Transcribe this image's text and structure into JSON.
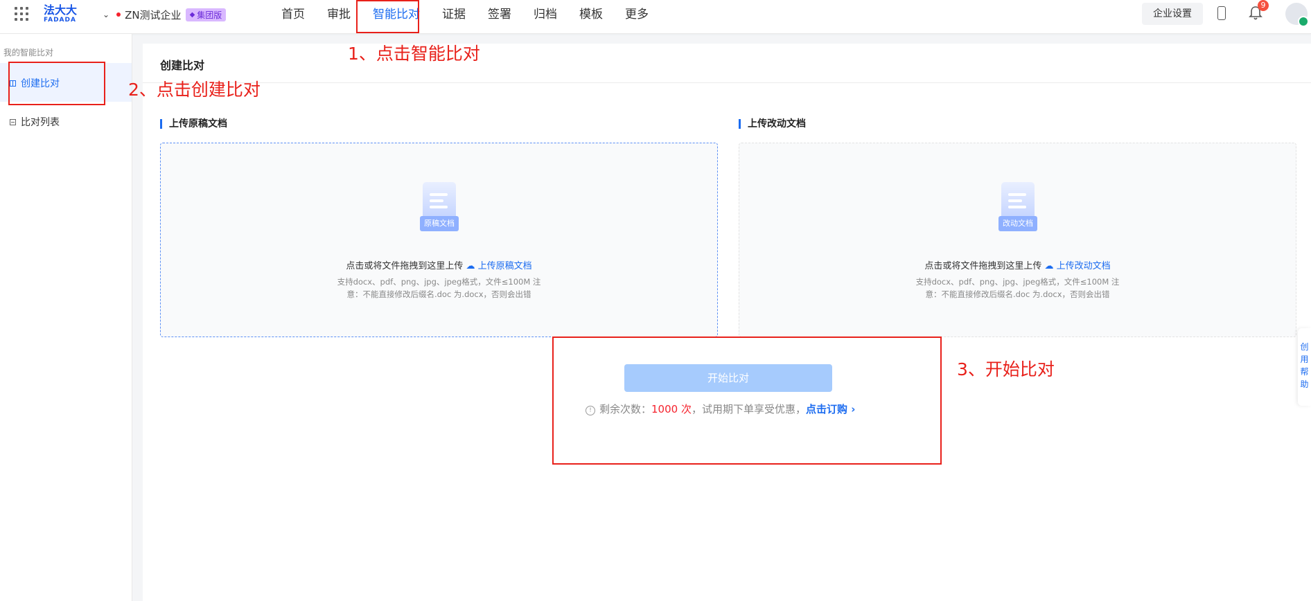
{
  "header": {
    "logo_cn": "法大大",
    "logo_en": "FADADA",
    "org_name": "ZN测试企业",
    "org_badge": "集团版",
    "nav": [
      {
        "label": "首页"
      },
      {
        "label": "审批"
      },
      {
        "label": "智能比对",
        "active": true
      },
      {
        "label": "证据"
      },
      {
        "label": "签署"
      },
      {
        "label": "归档"
      },
      {
        "label": "模板"
      },
      {
        "label": "更多"
      }
    ],
    "settings_label": "企业设置",
    "notification_count": "9"
  },
  "sidebar": {
    "group_title": "我的智能比对",
    "items": [
      {
        "label": "创建比对",
        "active": true
      },
      {
        "label": "比对列表"
      }
    ]
  },
  "main": {
    "title": "创建比对",
    "original": {
      "section_title": "上传原稿文档",
      "icon_tag": "原稿文档",
      "prompt": "点击或将文件拖拽到这里上传",
      "link": "上传原稿文档",
      "hint_line1": "支持docx、pdf、png、jpg、jpeg格式，文件≤100M 注",
      "hint_line2": "意：不能直接修改后缀名.doc 为.docx，否则会出错"
    },
    "revised": {
      "section_title": "上传改动文档",
      "icon_tag": "改动文档",
      "prompt": "点击或将文件拖拽到这里上传",
      "link": "上传改动文档",
      "hint_line1": "支持docx、pdf、png、jpg、jpeg格式，文件≤100M 注",
      "hint_line2": "意：不能直接修改后缀名.doc 为.docx，否则会出错"
    },
    "start_button": "开始比对",
    "remain_prefix": "剩余次数：",
    "remain_count": "1000 次",
    "remain_suffix": "，试用期下单享受优惠，",
    "buy_link": "点击订购"
  },
  "annotations": {
    "step1": "1、点击智能比对",
    "step2": "2、点击创建比对",
    "step3": "3、开始比对"
  },
  "float_panel": {
    "chars": [
      "创",
      "用",
      "帮",
      "助"
    ]
  },
  "colors": {
    "primary": "#1c6cf0",
    "annotation": "#e8201a",
    "disabled_button": "#a6cbfd",
    "count_red": "#f5222d"
  }
}
